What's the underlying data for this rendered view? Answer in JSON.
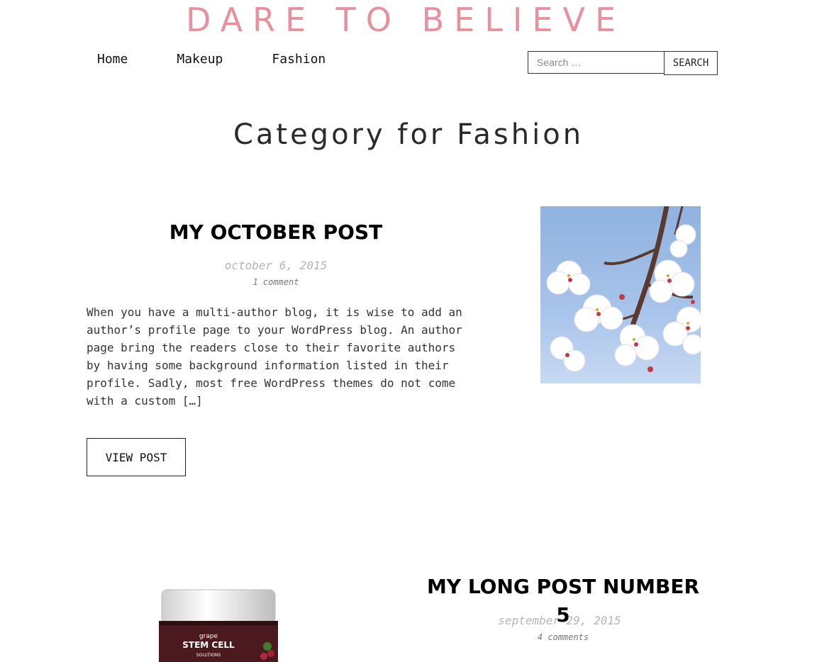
{
  "site": {
    "title": "DARE TO BELIEVE"
  },
  "nav": {
    "items": [
      "Home",
      "Makeup",
      "Fashion"
    ]
  },
  "search": {
    "placeholder": "Search …",
    "value": "",
    "button_label": "SEARCH"
  },
  "page": {
    "heading": "Category for Fashion"
  },
  "posts": [
    {
      "title": "MY OCTOBER POST",
      "date": "october 6, 2015",
      "comments": "1 comment",
      "excerpt": "When you have a multi-author blog, it is wise to add an author’s profile page to your WordPress blog. An author page bring the readers close to their favorite authors by having some background information listed in their profile. Sadly, most free WordPress themes do not come with a custom […]",
      "button_label": "VIEW POST"
    },
    {
      "title": "MY LONG POST NUMBER 5",
      "date": "september 29, 2015",
      "comments": "4 comments",
      "jar_text": [
        "grape",
        "STEM CELL",
        "SOLUTIONS"
      ]
    }
  ],
  "colors": {
    "brand": "#e8919e",
    "text": "#222222",
    "muted": "#b5b5b5"
  }
}
